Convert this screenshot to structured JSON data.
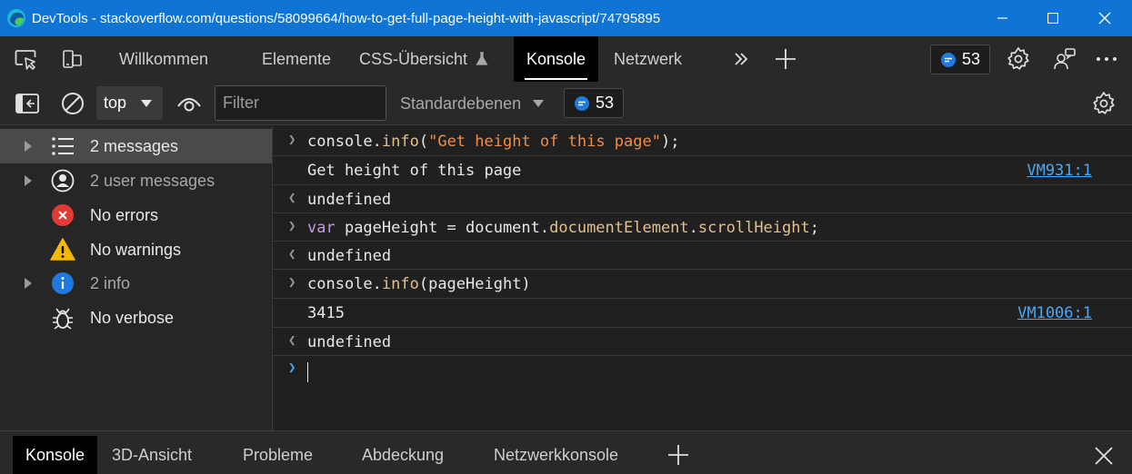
{
  "window": {
    "title": "DevTools - stackoverflow.com/questions/58099664/how-to-get-full-page-height-with-javascript/74795895"
  },
  "main_toolbar": {
    "tabs": [
      "Willkommen",
      "Elemente",
      "CSS-Übersicht",
      "Konsole",
      "Netzwerk"
    ],
    "active_tab": "Konsole",
    "issues_count": "53"
  },
  "console_toolbar": {
    "context": "top",
    "filter_placeholder": "Filter",
    "levels_label": "Standardebenen",
    "issues_count": "53"
  },
  "sidebar": {
    "items": [
      {
        "label": "2 messages",
        "icon": "list-icon",
        "expandable": true,
        "selected": true
      },
      {
        "label": "2 user messages",
        "icon": "user-icon",
        "expandable": true,
        "selected": false
      },
      {
        "label": "No errors",
        "icon": "error-icon",
        "expandable": false,
        "selected": false
      },
      {
        "label": "No warnings",
        "icon": "warning-icon",
        "expandable": false,
        "selected": false
      },
      {
        "label": "2 info",
        "icon": "info-icon",
        "expandable": true,
        "selected": false
      },
      {
        "label": "No verbose",
        "icon": "bug-icon",
        "expandable": false,
        "selected": false
      }
    ]
  },
  "console": {
    "entries": [
      {
        "kind": "input",
        "text": "console.info(\"Get height of this page\");"
      },
      {
        "kind": "output",
        "text": "Get height of this page",
        "source": "VM931:1"
      },
      {
        "kind": "result",
        "text": "undefined"
      },
      {
        "kind": "input",
        "text": "var pageHeight = document.documentElement.scrollHeight;"
      },
      {
        "kind": "result",
        "text": "undefined"
      },
      {
        "kind": "input",
        "text": "console.info(pageHeight)"
      },
      {
        "kind": "output",
        "text": "3415",
        "source": "VM1006:1"
      },
      {
        "kind": "result",
        "text": "undefined"
      }
    ]
  },
  "drawer": {
    "tabs": [
      "Konsole",
      "3D-Ansicht",
      "Probleme",
      "Abdeckung",
      "Netzwerkkonsole"
    ],
    "active_tab": "Konsole"
  },
  "colors": {
    "titlebar": "#0f74d4",
    "link": "#4ea6f0",
    "keyword": "#c49cde",
    "function": "#e2c08d",
    "string": "#f08d49",
    "number": "#9a9aff",
    "error": "#e53935",
    "warning": "#f5b800",
    "info": "#1f7ae0"
  }
}
